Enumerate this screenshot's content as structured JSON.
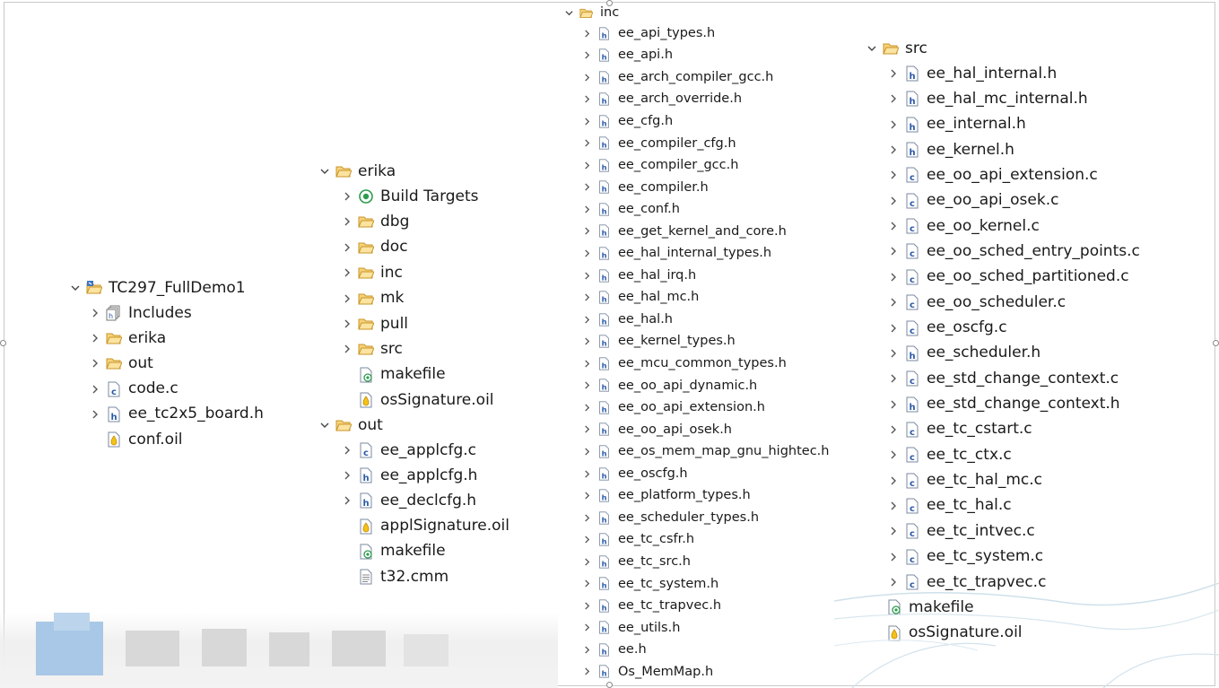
{
  "project_tree": {
    "root": "TC297_FullDemo1",
    "items": [
      {
        "label": "Includes",
        "icon": "includes-icon",
        "chev": "right"
      },
      {
        "label": "erika",
        "icon": "folder-icon",
        "chev": "right"
      },
      {
        "label": "out",
        "icon": "folder-icon",
        "chev": "right"
      },
      {
        "label": "code.c",
        "icon": "c-file-icon",
        "chev": "right"
      },
      {
        "label": "ee_tc2x5_board.h",
        "icon": "h-file-icon",
        "chev": "right"
      },
      {
        "label": "conf.oil",
        "icon": "oil-file-icon",
        "chev": "none"
      }
    ]
  },
  "erika_tree": {
    "root": "erika",
    "items": [
      {
        "label": "Build Targets",
        "icon": "build-targets-icon",
        "chev": "right"
      },
      {
        "label": "dbg",
        "icon": "folder-icon",
        "chev": "right"
      },
      {
        "label": "doc",
        "icon": "folder-icon",
        "chev": "right"
      },
      {
        "label": "inc",
        "icon": "folder-icon",
        "chev": "right"
      },
      {
        "label": "mk",
        "icon": "folder-icon",
        "chev": "right"
      },
      {
        "label": "pull",
        "icon": "folder-icon",
        "chev": "right"
      },
      {
        "label": "src",
        "icon": "folder-icon",
        "chev": "right"
      },
      {
        "label": "makefile",
        "icon": "makefile-icon",
        "chev": "none"
      },
      {
        "label": "osSignature.oil",
        "icon": "oil-file-icon",
        "chev": "none"
      }
    ],
    "out_root": "out",
    "out_items": [
      {
        "label": "ee_applcfg.c",
        "icon": "c-file-icon",
        "chev": "right"
      },
      {
        "label": "ee_applcfg.h",
        "icon": "h-file-icon",
        "chev": "right"
      },
      {
        "label": "ee_declcfg.h",
        "icon": "h-file-icon",
        "chev": "right"
      },
      {
        "label": "applSignature.oil",
        "icon": "oil-file-icon",
        "chev": "none"
      },
      {
        "label": "makefile",
        "icon": "makefile-icon",
        "chev": "none"
      },
      {
        "label": "t32.cmm",
        "icon": "text-file-icon",
        "chev": "none"
      }
    ]
  },
  "inc_tree": {
    "root": "inc",
    "items": [
      "ee_api_types.h",
      "ee_api.h",
      "ee_arch_compiler_gcc.h",
      "ee_arch_override.h",
      "ee_cfg.h",
      "ee_compiler_cfg.h",
      "ee_compiler_gcc.h",
      "ee_compiler.h",
      "ee_conf.h",
      "ee_get_kernel_and_core.h",
      "ee_hal_internal_types.h",
      "ee_hal_irq.h",
      "ee_hal_mc.h",
      "ee_hal.h",
      "ee_kernel_types.h",
      "ee_mcu_common_types.h",
      "ee_oo_api_dynamic.h",
      "ee_oo_api_extension.h",
      "ee_oo_api_osek.h",
      "ee_os_mem_map_gnu_hightec.h",
      "ee_oscfg.h",
      "ee_platform_types.h",
      "ee_scheduler_types.h",
      "ee_tc_csfr.h",
      "ee_tc_src.h",
      "ee_tc_system.h",
      "ee_tc_trapvec.h",
      "ee_utils.h",
      "ee.h",
      "Os_MemMap.h"
    ]
  },
  "src_tree": {
    "root": "src",
    "items": [
      {
        "label": "ee_hal_internal.h",
        "icon": "h-file-icon",
        "chev": "right"
      },
      {
        "label": "ee_hal_mc_internal.h",
        "icon": "h-file-icon",
        "chev": "right"
      },
      {
        "label": "ee_internal.h",
        "icon": "h-file-icon",
        "chev": "right"
      },
      {
        "label": "ee_kernel.h",
        "icon": "h-file-icon",
        "chev": "right"
      },
      {
        "label": "ee_oo_api_extension.c",
        "icon": "c-file-icon",
        "chev": "right"
      },
      {
        "label": "ee_oo_api_osek.c",
        "icon": "c-file-icon",
        "chev": "right"
      },
      {
        "label": "ee_oo_kernel.c",
        "icon": "c-file-icon",
        "chev": "right"
      },
      {
        "label": "ee_oo_sched_entry_points.c",
        "icon": "c-file-icon",
        "chev": "right"
      },
      {
        "label": "ee_oo_sched_partitioned.c",
        "icon": "c-file-icon",
        "chev": "right"
      },
      {
        "label": "ee_oo_scheduler.c",
        "icon": "c-file-icon",
        "chev": "right"
      },
      {
        "label": "ee_oscfg.c",
        "icon": "c-file-icon",
        "chev": "right"
      },
      {
        "label": "ee_scheduler.h",
        "icon": "h-file-icon",
        "chev": "right"
      },
      {
        "label": "ee_std_change_context.c",
        "icon": "c-file-icon",
        "chev": "right"
      },
      {
        "label": "ee_std_change_context.h",
        "icon": "h-file-icon",
        "chev": "right"
      },
      {
        "label": "ee_tc_cstart.c",
        "icon": "c-file-icon",
        "chev": "right"
      },
      {
        "label": "ee_tc_ctx.c",
        "icon": "c-file-icon",
        "chev": "right"
      },
      {
        "label": "ee_tc_hal_mc.c",
        "icon": "c-file-icon",
        "chev": "right"
      },
      {
        "label": "ee_tc_hal.c",
        "icon": "c-file-icon",
        "chev": "right"
      },
      {
        "label": "ee_tc_intvec.c",
        "icon": "c-file-icon",
        "chev": "right"
      },
      {
        "label": "ee_tc_system.c",
        "icon": "c-file-icon",
        "chev": "right"
      },
      {
        "label": "ee_tc_trapvec.c",
        "icon": "c-file-icon",
        "chev": "right"
      },
      {
        "label": "makefile",
        "icon": "makefile-icon",
        "chev": "none"
      },
      {
        "label": "osSignature.oil",
        "icon": "oil-file-icon",
        "chev": "none"
      }
    ]
  },
  "colors": {
    "folder_fill": "#f6d27a",
    "folder_stroke": "#c9962a",
    "file_blue": "#2b5aa8",
    "oil_fill": "#f3c21b",
    "build_green": "#2e9b4e"
  }
}
